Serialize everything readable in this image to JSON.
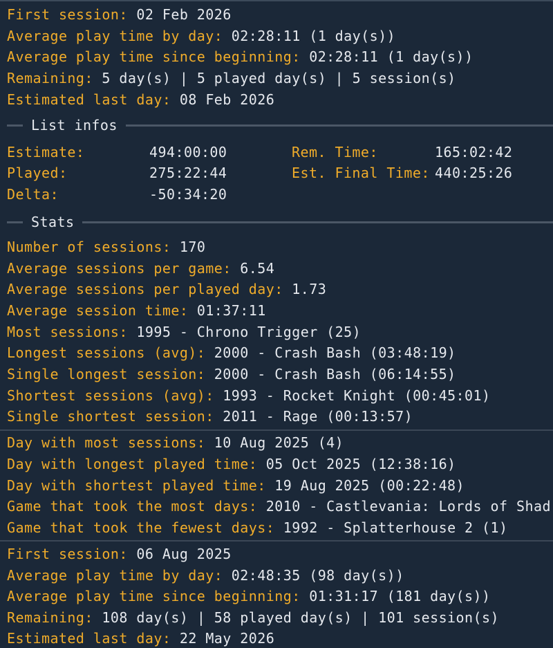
{
  "section1": {
    "first_session_label": "First session:",
    "first_session_value": "02 Feb 2026",
    "avg_by_day_label": "Average play time by day:",
    "avg_by_day_value": "02:28:11 (1 day(s))",
    "avg_since_label": "Average play time since beginning:",
    "avg_since_value": "02:28:11 (1 day(s))",
    "remaining_label": "Remaining:",
    "remaining_value": "5 day(s) | 5 played day(s) | 5 session(s)",
    "est_last_label": "Estimated last day:",
    "est_last_value": "08 Feb 2026"
  },
  "list_infos": {
    "title": "List infos",
    "estimate_label": "Estimate:",
    "estimate_value": "494:00:00",
    "played_label": "Played:",
    "played_value": "275:22:44",
    "delta_label": "Delta:",
    "delta_value": "-50:34:20",
    "rem_time_label": "Rem. Time:",
    "rem_time_value": "165:02:42",
    "est_final_label": "Est. Final Time:",
    "est_final_value": "440:25:26"
  },
  "stats": {
    "title": "Stats",
    "rows": [
      {
        "label": "Number of sessions:",
        "value": "170"
      },
      {
        "label": "Average sessions per game:",
        "value": "6.54"
      },
      {
        "label": "Average sessions per played day:",
        "value": "1.73"
      },
      {
        "label": "Average session time:",
        "value": "01:37:11"
      },
      {
        "label": "Most sessions:",
        "value": "1995 - Chrono Trigger (25)"
      },
      {
        "label": "Longest sessions (avg):",
        "value": "2000 - Crash Bash (03:48:19)"
      },
      {
        "label": "Single longest session:",
        "value": "2000 - Crash Bash (06:14:55)"
      },
      {
        "label": "Shortest sessions (avg):",
        "value": "1993 - Rocket Knight (00:45:01)"
      },
      {
        "label": "Single shortest session:",
        "value": "2011 - Rage (00:13:57)"
      }
    ],
    "days": [
      {
        "label": "Day with most sessions:",
        "value": "10 Aug 2025 (4)"
      },
      {
        "label": "Day with longest played time:",
        "value": "05 Oct 2025 (12:38:16)"
      },
      {
        "label": "Day with shortest played time:",
        "value": "19 Aug 2025 (00:22:48)"
      },
      {
        "label": "Game that took the most days:",
        "value": "2010 - Castlevania: Lords of Shad"
      },
      {
        "label": "Game that took the fewest days:",
        "value": "1992 - Splatterhouse 2 (1)"
      }
    ]
  },
  "section2": {
    "first_session_label": "First session:",
    "first_session_value": "06 Aug 2025",
    "avg_by_day_label": "Average play time by day:",
    "avg_by_day_value": "02:48:35 (98 day(s))",
    "avg_since_label": "Average play time since beginning:",
    "avg_since_value": "01:31:17 (181 day(s))",
    "remaining_label": "Remaining:",
    "remaining_value": "108 day(s) | 58 played day(s) | 101 session(s)",
    "est_last_label": "Estimated last day:",
    "est_last_value": "22 May 2026"
  },
  "colors": {
    "background": "#1b2838",
    "label": "#f0ac2a",
    "value": "#e6e9ee",
    "separator": "#3b4756"
  }
}
